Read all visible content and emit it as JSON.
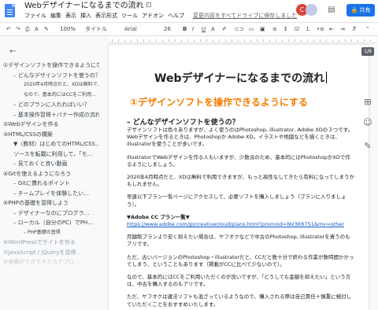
{
  "doc": {
    "title": "Webデザイナーになるまでの流れ",
    "menu": [
      "ファイル",
      "編集",
      "表示",
      "挿入",
      "表示形式",
      "ツール",
      "アドオン",
      "ヘルプ"
    ],
    "last_edit": "変更内容をすべてドライブに保存しました"
  },
  "header": {
    "share_label": "共有",
    "avatar_initial": "C"
  },
  "toolbar": {
    "zoom": "100%",
    "style": "タイトル",
    "font": "Arial",
    "size": "26"
  },
  "outline": [
    {
      "text": "①デザインソフトを操作できるようになる",
      "level": 1
    },
    {
      "text": "– どんなデザインソフトを使うの？",
      "level": 2
    },
    {
      "text": "2020年4月時点だと、XDは無料で…",
      "level": 3
    },
    {
      "text": "なので、基本的にはCCをご利用…",
      "level": 3
    },
    {
      "text": "– どのプランに入れればいい？",
      "level": 2
    },
    {
      "text": "– 基本操作習得＋バナー作成の流れ",
      "level": 2
    },
    {
      "text": "②Webデザインを作る",
      "level": 1
    },
    {
      "text": "③HTML/CSSの構築",
      "level": 1
    },
    {
      "text": "▼（教材）はじめてのHTML/CSS…",
      "level": 2
    },
    {
      "text": "ソースを転載に利用して、「モ…",
      "level": 2
    },
    {
      "text": "– 見ておくと良い動画",
      "level": 2
    },
    {
      "text": "④Gitを使えるようになろう",
      "level": 1
    },
    {
      "text": "– Gitに慣れるポイント",
      "level": 2
    },
    {
      "text": "– チームプレイを体験したい…",
      "level": 2
    },
    {
      "text": "⑤PHPの基礎を習得しよう",
      "level": 1
    },
    {
      "text": "– デザイナーなのにプログラ…",
      "level": 2
    },
    {
      "text": "– ローカル（自分のPC）でPH…",
      "level": 2
    },
    {
      "text": "– PHP基礎の習得",
      "level": 3
    },
    {
      "text": "⑥WordPressでサイトを作る",
      "level": 1,
      "faded": 1
    },
    {
      "text": "⑦JavaScript / jQueryを習得…",
      "level": 1,
      "faded": 1
    },
    {
      "text": "⑧実績ができてきたらアプロ…",
      "level": 1,
      "faded": 2
    }
  ],
  "page": {
    "page_counter": "1/8",
    "heading": "Webデザイナーになるまでの流れ",
    "section1": "①デザインソフトを操作できるようにする",
    "section1_sub": "– どんなデザインソフトを使うの？",
    "paragraphs": [
      "デザインソフトは色々ありますが、よく使うのはPhotoshop, illustrator, Adobe XDの３つです。Webデザインを作るときは、Photoshopか Adobe XD。イラストや地図などを描くときは、illustratorを使うことが多いです。",
      "illustratorでWebデザインを作る人もいますが、少数派のため、基本的にはPhotoshopかXDで作るようにしましょう。",
      "2020年4月時点だと、XDは無料で利用できますが、もっと高性なしてきたら有料になってしまうかもしれません。",
      "早速以下プラン一覧ページにアクセスして、必要ソフトを購入しましょう（プランに入りましょう）。",
      "▼Adobe CC プラン一覧▼",
      "https://www.adobe.com/jp/creativecloud/plans.html?promoid=NV3KR7S1&mv=other",
      "月額制プランより安く抑えたい場合は、ヤフオクなどで中古のPhotoshop, illustratorを買うのもアリです。",
      "ただ、古いバージョンのPhotoshop・illustratorだと、CCだと数十分で終わる作業が数時間かかってしまう、ということもあります（掲載がCCに比べて少ないので）。",
      "なので、基本的にはCCをご利用いただくのが良いですが、「どうしても金額を抑えたい」という方は、中古を購入するのもアリです。",
      "ただ、ヤフオクは違法ソフトも混ざっているようなので、購入される際は自己責任＋慎重に検討していただくことをおすすめいたします。"
    ]
  }
}
